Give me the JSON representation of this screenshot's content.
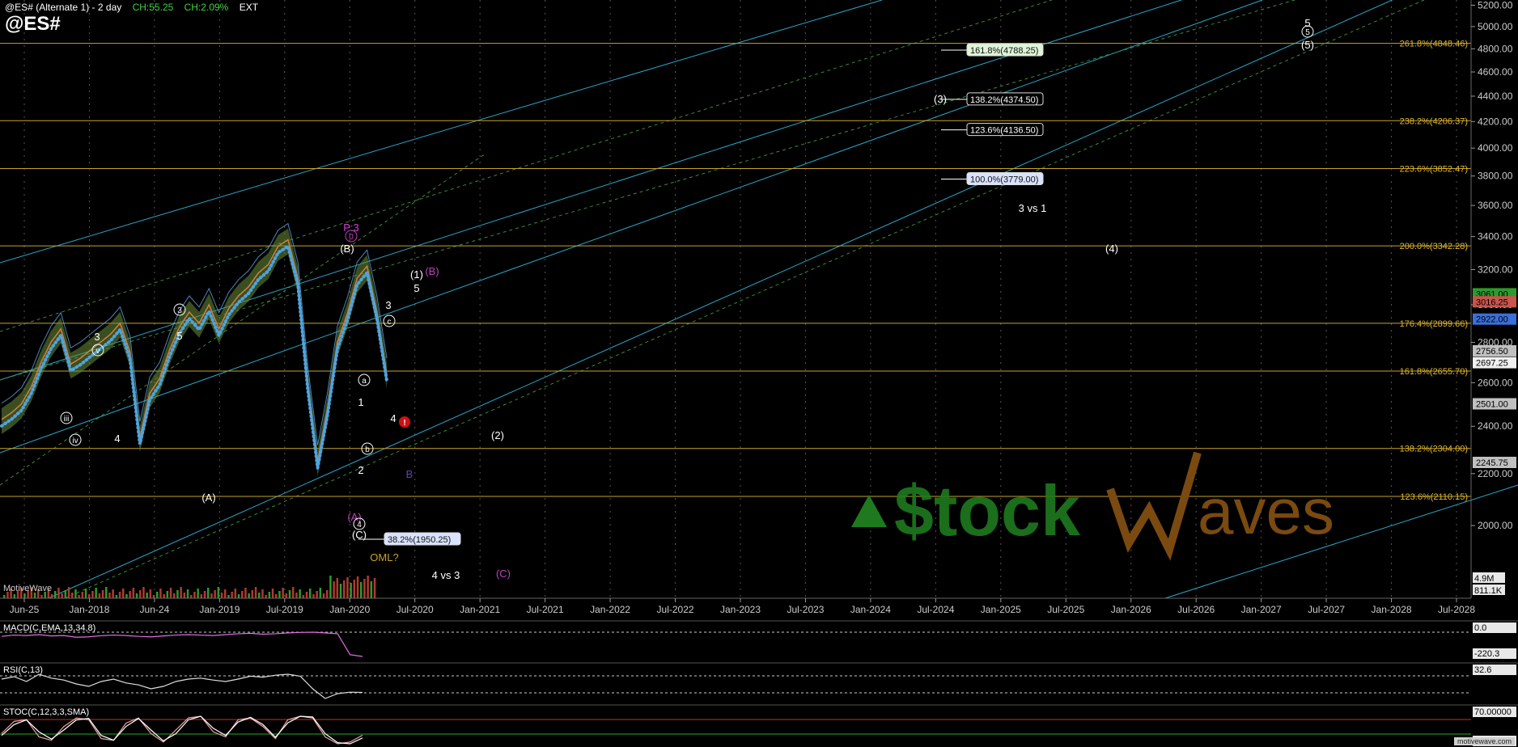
{
  "header": {
    "title": "@ES# (Alternate 1) - 2 day",
    "ch_pts": "CH:55.25",
    "ch_pct": "CH:2.09%",
    "session": "EXT",
    "symbol": "@ES#"
  },
  "branding": {
    "source": "MotiveWave",
    "watermark": "Stockwaves",
    "footer": "motivewave.com"
  },
  "colors": {
    "background": "#000000",
    "fib_line": "#c9a227",
    "fib_text": "#e0b830",
    "trend_cyan": "#2aa7c9",
    "trend_green": "#3a8a3a",
    "price_line": "#5aa9e6",
    "cloud": "#6b8e3a",
    "macd": "#e070e0",
    "axis_text": "#cccccc",
    "grid": "#555555",
    "watermark_green": "#1f7a1f",
    "watermark_brown": "#7a4a10"
  },
  "chart_data": [
    {
      "type": "line",
      "title": "@ES# (Alternate 1) - 2 day",
      "y_scale": "log",
      "ylim": [
        1750,
        5250
      ],
      "y_ticks": [
        5200,
        5000,
        4800,
        4600,
        4400,
        4200,
        4000,
        3800,
        3600,
        3400,
        3200,
        3000,
        2800,
        2600,
        2400,
        2200,
        2000
      ],
      "x_ticks": [
        "Jun-25",
        "Jan-2018",
        "Jun-24",
        "Jan-2019",
        "Jul-2019",
        "Jan-2020",
        "Jul-2020",
        "Jan-2021",
        "Jul-2021",
        "Jan-2022",
        "Jul-2022",
        "Jan-2023",
        "Jul-2023",
        "Jan-2024",
        "Jul-2024",
        "Jan-2025",
        "Jul-2025",
        "Jan-2026",
        "Jul-2026",
        "Jan-2027",
        "Jul-2027",
        "Jan-2028",
        "Jul-2028"
      ],
      "grid": true,
      "series": [
        {
          "values": [
            2430,
            2460,
            2500,
            2580,
            2700,
            2800,
            2870,
            2690,
            2720,
            2760,
            2800,
            2840,
            2900,
            2750,
            2350,
            2550,
            2620,
            2760,
            2880,
            2960,
            2900,
            3000,
            2870,
            2980,
            3050,
            3100,
            3180,
            3230,
            3340,
            3380,
            3150,
            2600,
            2250,
            2480,
            2800,
            2950,
            3150,
            3220,
            2960,
            2640
          ]
        }
      ],
      "fib_levels": [
        {
          "label": "261.8%(4848.46)",
          "value": 4848.46
        },
        {
          "label": "238.2%(4206.37)",
          "value": 4206.37
        },
        {
          "label": "223.6%(3852.47)",
          "value": 3852.47
        },
        {
          "label": "200.0%(3342.28)",
          "value": 3342.28
        },
        {
          "label": "176.4%(2899.66)",
          "value": 2899.66
        },
        {
          "label": "161.8%(2655.70)",
          "value": 2655.7
        },
        {
          "label": "138.2%(2304.00)",
          "value": 2304.0
        },
        {
          "label": "123.6%(2110.15)",
          "value": 2110.15
        }
      ],
      "targets": [
        {
          "label": "161.8%(4788.25)",
          "value": 4788.25,
          "style": "green"
        },
        {
          "label": "138.2%(4374.50)",
          "value": 4374.5,
          "style": "white"
        },
        {
          "label": "123.6%(4136.50)",
          "value": 4136.5,
          "style": "white"
        },
        {
          "label": "100.0%(3779.00)",
          "value": 3779.0,
          "style": "blue"
        },
        {
          "label": "38.2%(1950.25)",
          "value": 1950.25,
          "style": "blue"
        }
      ],
      "price_tags": [
        {
          "label": "3061.00",
          "value": 3061,
          "bg": "#2e9a2e"
        },
        {
          "label": "3016.25",
          "value": 3016.25,
          "bg": "#c8544c"
        },
        {
          "label": "2922.00",
          "value": 2922,
          "bg": "#3a6fd8"
        },
        {
          "label": "2756.50",
          "value": 2756.5,
          "bg": "#c0c0c0"
        },
        {
          "label": "2697.25",
          "value": 2697.25,
          "bg": "#f0f0f0"
        },
        {
          "label": "2501.00",
          "value": 2501,
          "bg": "#c0c0c0"
        },
        {
          "label": "2245.75",
          "value": 2245.75,
          "bg": "#c0c0c0"
        }
      ],
      "volume_tags": [
        "4.9M",
        "811.1K"
      ],
      "wave_labels": [
        {
          "text": "(3)",
          "color": "#ffffff"
        },
        {
          "text": "3 vs 1",
          "color": "#ffffff"
        },
        {
          "text": "(4)",
          "color": "#ffffff"
        },
        {
          "text": "5",
          "color": "#ffffff"
        },
        {
          "text": "(5)",
          "color": "#ffffff"
        },
        {
          "text": "(B)",
          "color": "#ffffff"
        },
        {
          "text": "P:3",
          "color": "#d040d0"
        },
        {
          "text": "(1)",
          "color": "#ffffff"
        },
        {
          "text": "(B)",
          "color": "#c040c0"
        },
        {
          "text": "5",
          "color": "#ffffff"
        },
        {
          "text": "3",
          "color": "#ffffff"
        },
        {
          "text": "3",
          "color": "#ffffff"
        },
        {
          "text": "5",
          "color": "#ffffff"
        },
        {
          "text": "4",
          "color": "#ffffff"
        },
        {
          "text": "4",
          "color": "#ffffff"
        },
        {
          "text": "(2)",
          "color": "#ffffff"
        },
        {
          "text": "B",
          "color": "#6040c0"
        },
        {
          "text": "(A)",
          "color": "#ffffff"
        },
        {
          "text": "2",
          "color": "#ffffff"
        },
        {
          "text": "1",
          "color": "#ffffff"
        },
        {
          "text": "(C)",
          "color": "#ffffff"
        },
        {
          "text": "OML?",
          "color": "#c9a227"
        },
        {
          "text": "4 vs 3",
          "color": "#ffffff"
        },
        {
          "text": "(C)",
          "color": "#c040c0"
        },
        {
          "text": "(A)",
          "color": "#c040c0"
        }
      ],
      "circled_labels": [
        {
          "text": "5",
          "color": "#ffffff"
        },
        {
          "text": "3",
          "color": "#ffffff"
        },
        {
          "text": "4",
          "color": "#ffffff"
        },
        {
          "text": "v",
          "color": "#ffffff"
        },
        {
          "text": "iii",
          "color": "#ffffff"
        },
        {
          "text": "iv",
          "color": "#ffffff"
        },
        {
          "text": "c",
          "color": "#ffffff"
        },
        {
          "text": "a",
          "color": "#ffffff"
        },
        {
          "text": "b",
          "color": "#ffffff"
        },
        {
          "text": "0",
          "color": "#c040c0"
        }
      ],
      "alert": "!"
    },
    {
      "type": "line",
      "title": "MACD(C,EMA,13,34,8)",
      "y_ticks": [
        "0.0",
        "-220.3"
      ],
      "series": [
        {
          "values": [
            10,
            25,
            20,
            30,
            15,
            20,
            0,
            5,
            18,
            25,
            20,
            10,
            5,
            15,
            25,
            30,
            25,
            20,
            30,
            40,
            45,
            35,
            40,
            50,
            55,
            58,
            50,
            40,
            -200,
            -220
          ]
        }
      ]
    },
    {
      "type": "line",
      "title": "RSI(C,13)",
      "y_ticks": [
        "32.6"
      ],
      "series": [
        {
          "values": [
            60,
            65,
            55,
            70,
            62,
            58,
            50,
            45,
            55,
            60,
            52,
            48,
            40,
            45,
            55,
            60,
            62,
            58,
            55,
            60,
            66,
            64,
            68,
            70,
            66,
            40,
            20,
            30,
            33,
            32.6
          ]
        }
      ]
    },
    {
      "type": "line",
      "title": "STOC(C,12,3,3,SMA)",
      "y_ticks": [
        "70.00000",
        "30.00000"
      ],
      "series": [
        {
          "values": [
            40,
            75,
            80,
            30,
            20,
            60,
            85,
            80,
            25,
            20,
            70,
            85,
            40,
            15,
            50,
            85,
            90,
            45,
            30,
            80,
            85,
            60,
            25,
            80,
            90,
            85,
            30,
            10,
            15,
            35
          ]
        },
        {
          "values": [
            35,
            65,
            78,
            45,
            25,
            50,
            78,
            82,
            35,
            22,
            60,
            82,
            50,
            20,
            40,
            78,
            88,
            55,
            35,
            72,
            85,
            65,
            30,
            70,
            88,
            86,
            40,
            15,
            12,
            28
          ]
        }
      ]
    }
  ]
}
